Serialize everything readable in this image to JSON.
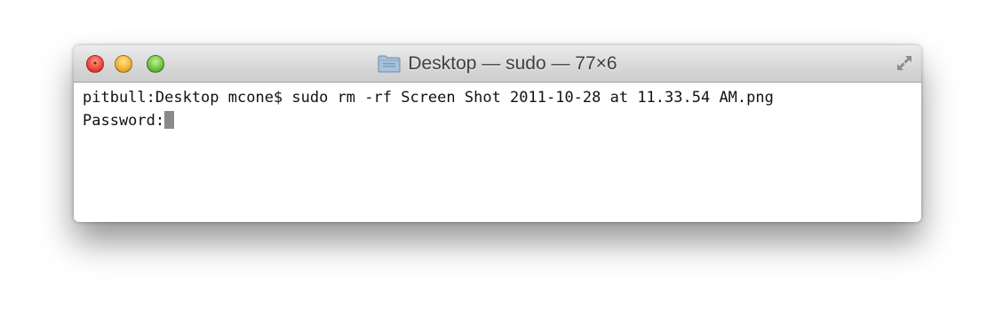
{
  "window": {
    "title": "Desktop — sudo — 77×6",
    "title_icon": "folder-icon",
    "buttons": {
      "close_icon": "close-icon",
      "minimize_icon": "minimize-icon",
      "zoom_icon": "zoom-icon",
      "fullscreen_icon": "fullscreen-icon"
    }
  },
  "terminal": {
    "lines": [
      "pitbull:Desktop mcone$ sudo rm -rf Screen Shot 2011-10-28 at 11.33.54 AM.png",
      "Password:"
    ],
    "cursor_color": "#8a8a8a",
    "text_color": "#111111",
    "background": "#ffffff"
  },
  "colors": {
    "close": "#f04a3c",
    "minimize": "#f3b43a",
    "zoom": "#74c444"
  }
}
